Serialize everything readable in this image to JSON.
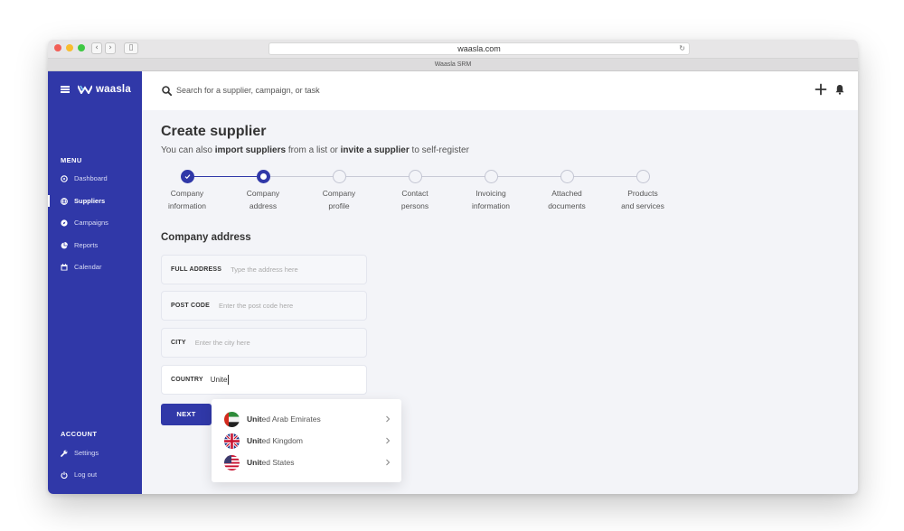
{
  "browser": {
    "url": "waasla.com",
    "tab_title": "Waasla SRM"
  },
  "app": {
    "logo_text": "waasla"
  },
  "colors": {
    "brand": "#3038a8",
    "background": "#f3f4f8"
  },
  "sidebar": {
    "menu_heading": "MENU",
    "items": [
      {
        "label": "Dashboard",
        "icon": "dashboard-icon"
      },
      {
        "label": "Suppliers",
        "icon": "globe-icon",
        "active": true
      },
      {
        "label": "Campaigns",
        "icon": "compass-icon"
      },
      {
        "label": "Reports",
        "icon": "pie-chart-icon"
      },
      {
        "label": "Calendar",
        "icon": "calendar-icon"
      }
    ],
    "account_heading": "ACCOUNT",
    "account_items": [
      {
        "label": "Settings",
        "icon": "wrench-icon"
      },
      {
        "label": "Log out",
        "icon": "power-icon"
      }
    ]
  },
  "header": {
    "search_placeholder": "Search for a supplier, campaign, or task"
  },
  "page": {
    "title": "Create supplier",
    "subtitle_1": "You can also ",
    "subtitle_link_1": "import suppliers",
    "subtitle_2": " from a list or ",
    "subtitle_link_2": "invite a supplier",
    "subtitle_3": " to self-register"
  },
  "steps": [
    {
      "line1": "Company",
      "line2": "information",
      "state": "done"
    },
    {
      "line1": "Company",
      "line2": "address",
      "state": "current"
    },
    {
      "line1": "Company",
      "line2": "profile",
      "state": "todo"
    },
    {
      "line1": "Contact",
      "line2": "persons",
      "state": "todo"
    },
    {
      "line1": "Invoicing",
      "line2": "information",
      "state": "todo"
    },
    {
      "line1": "Attached",
      "line2": "documents",
      "state": "todo"
    },
    {
      "line1": "Products",
      "line2": "and services",
      "state": "todo"
    }
  ],
  "form": {
    "section_title": "Company address",
    "full_address": {
      "label": "FULL ADDRESS",
      "placeholder": "Type the address here",
      "value": ""
    },
    "post_code": {
      "label": "POST CODE",
      "placeholder": "Enter the post code here",
      "value": ""
    },
    "city": {
      "label": "CITY",
      "placeholder": "Enter the city here",
      "value": ""
    },
    "country": {
      "label": "COUNTRY",
      "value": "Unite"
    },
    "next_label": "NEXT"
  },
  "country_dropdown": {
    "options": [
      {
        "match": "Unit",
        "rest": "ed Arab Emirates",
        "flag": "uae-flag-icon"
      },
      {
        "match": "Unit",
        "rest": "ed Kingdom",
        "flag": "uk-flag-icon"
      },
      {
        "match": "Unit",
        "rest": "ed States",
        "flag": "us-flag-icon"
      }
    ]
  }
}
